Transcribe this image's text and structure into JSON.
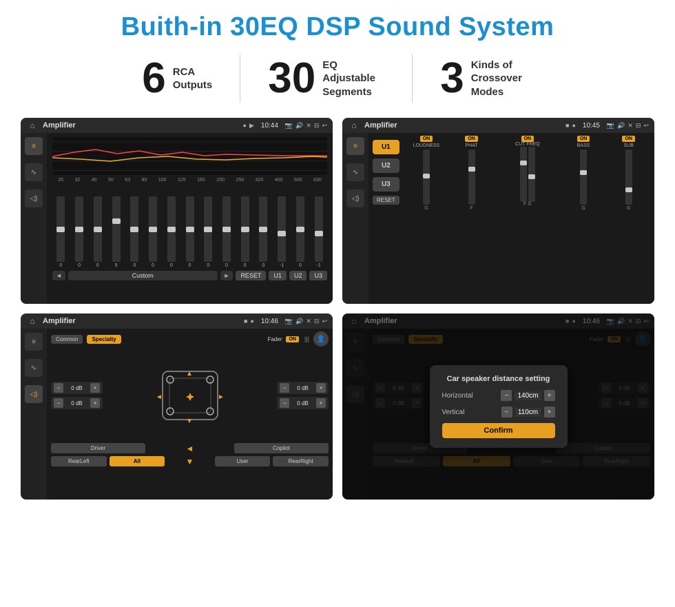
{
  "title": "Buith-in 30EQ DSP Sound System",
  "stats": [
    {
      "number": "6",
      "label": "RCA\nOutputs"
    },
    {
      "number": "30",
      "label": "EQ Adjustable\nSegments"
    },
    {
      "number": "3",
      "label": "Kinds of\nCrossover Modes"
    }
  ],
  "screens": [
    {
      "id": "eq-screen",
      "time": "10:44",
      "title": "Amplifier",
      "freq_labels": [
        "25",
        "32",
        "40",
        "50",
        "63",
        "80",
        "100",
        "125",
        "160",
        "200",
        "250",
        "320",
        "400",
        "500",
        "630"
      ],
      "slider_vals": [
        "0",
        "0",
        "0",
        "5",
        "0",
        "0",
        "0",
        "0",
        "0",
        "0",
        "0",
        "0",
        "-1",
        "0",
        "-1"
      ],
      "bottom_buttons": [
        "Custom",
        "RESET",
        "U1",
        "U2",
        "U3"
      ]
    },
    {
      "id": "crossover-screen",
      "time": "10:45",
      "title": "Amplifier",
      "u_buttons": [
        "U1",
        "U2",
        "U3"
      ],
      "channels": [
        "LOUDNESS",
        "PHAT",
        "CUT FREQ",
        "BASS",
        "SUB"
      ],
      "channel_labels": [
        "G",
        "F",
        "F G",
        "G"
      ],
      "reset_label": "RESET"
    },
    {
      "id": "fader-screen",
      "time": "10:46",
      "title": "Amplifier",
      "top_buttons": [
        "Common",
        "Specialty"
      ],
      "fader_label": "Fader",
      "on_label": "ON",
      "db_values": [
        "0 dB",
        "0 dB",
        "0 dB",
        "0 dB"
      ],
      "bottom_buttons": [
        "Driver",
        "",
        "User",
        "RearLeft",
        "All",
        "",
        "RearRight",
        "Copilot"
      ]
    },
    {
      "id": "dialog-screen",
      "time": "10:46",
      "title": "Amplifier",
      "top_buttons": [
        "Common",
        "Specialty"
      ],
      "dialog_title": "Car speaker distance setting",
      "horizontal_label": "Horizontal",
      "horizontal_val": "140cm",
      "vertical_label": "Vertical",
      "vertical_val": "110cm",
      "db_values_right": [
        "0 dB",
        "0 dB"
      ],
      "confirm_label": "Confirm",
      "bottom_buttons": [
        "Driver",
        "Copilot",
        "RearLef...",
        "User",
        "RearRight"
      ]
    }
  ]
}
